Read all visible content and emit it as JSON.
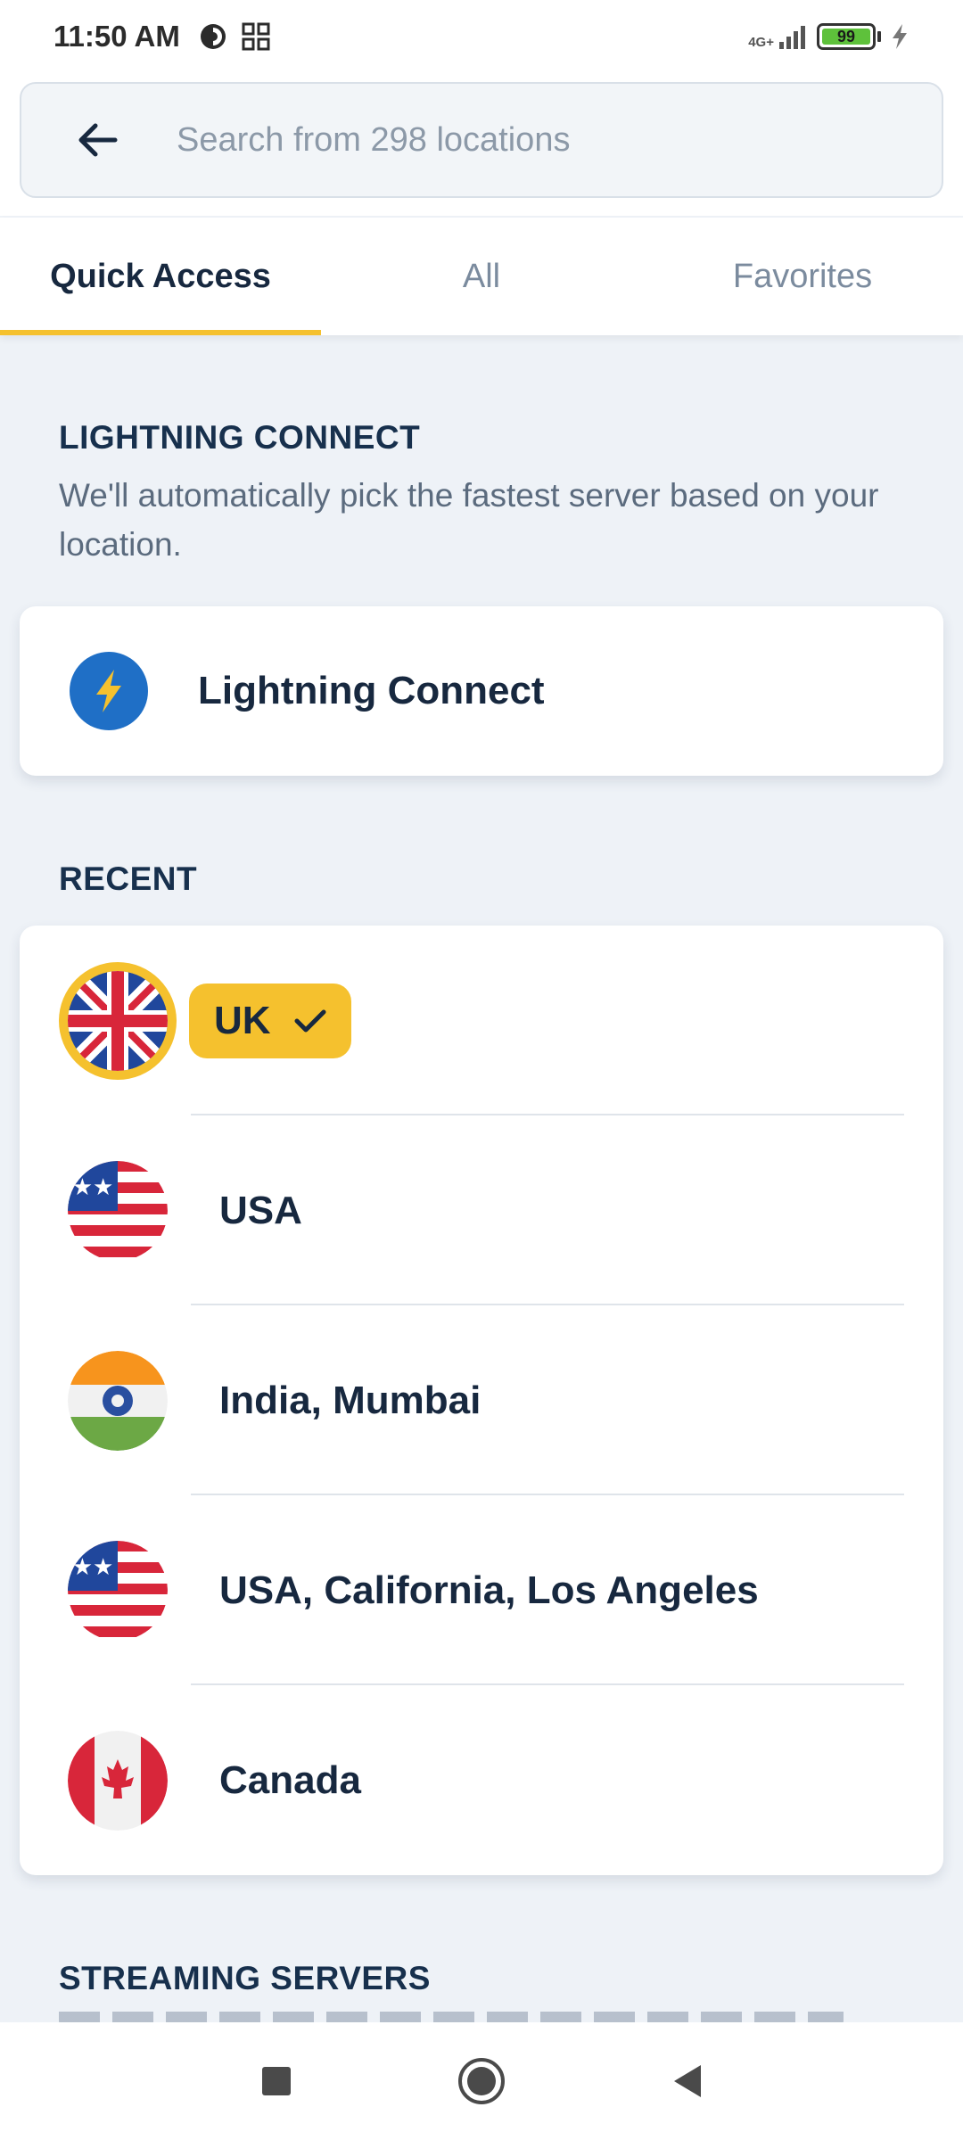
{
  "status_bar": {
    "time": "11:50 AM",
    "network": "4G+",
    "battery": "99"
  },
  "search": {
    "placeholder": "Search from 298 locations"
  },
  "tabs": [
    {
      "label": "Quick Access",
      "active": true
    },
    {
      "label": "All",
      "active": false
    },
    {
      "label": "Favorites",
      "active": false
    }
  ],
  "lightning": {
    "section_title": "LIGHTNING CONNECT",
    "description": "We'll automatically pick the fastest server based on your location.",
    "button_label": "Lightning Connect"
  },
  "recent": {
    "section_title": "RECENT",
    "items": [
      {
        "label": "UK",
        "flag": "uk-flag-icon",
        "selected": true
      },
      {
        "label": "USA",
        "flag": "usa-flag-icon",
        "selected": false
      },
      {
        "label": "India, Mumbai",
        "flag": "india-flag-icon",
        "selected": false
      },
      {
        "label": "USA, California, Los Angeles",
        "flag": "usa-flag-icon",
        "selected": false
      },
      {
        "label": "Canada",
        "flag": "canada-flag-icon",
        "selected": false
      }
    ]
  },
  "streaming": {
    "section_title": "STREAMING SERVERS"
  },
  "colors": {
    "accent": "#f5c12e",
    "primary_text": "#17283f",
    "lightning_blue": "#1f6fc6"
  }
}
